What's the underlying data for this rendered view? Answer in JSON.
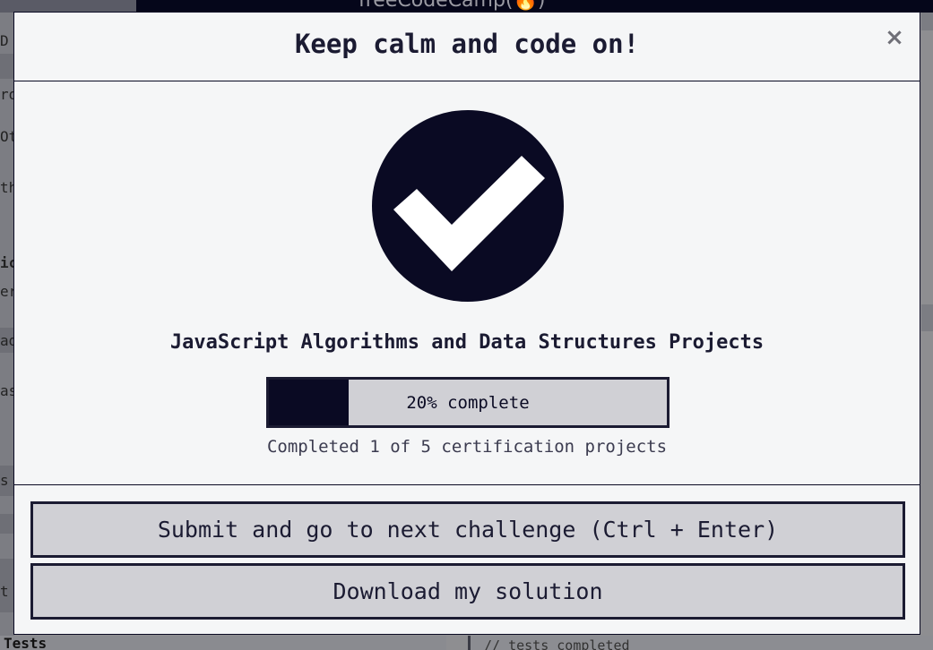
{
  "background": {
    "logo_text": "freeCodeCamp(🔥)",
    "left_fragments": [
      "D",
      "ro",
      "Ot",
      "th",
      "ic",
      "er",
      "ad",
      "as",
      "s",
      "t"
    ],
    "tests_label": "Tests",
    "code_snippet": "// tests completed"
  },
  "modal": {
    "title": "Keep calm and code on!",
    "close_symbol": "×",
    "success_icon": "checkmark-circle-icon",
    "certification_title": "JavaScript Algorithms and Data Structures Projects",
    "progress": {
      "fraction": 0.2,
      "label": "20% complete"
    },
    "progress_caption": "Completed 1 of 5 certification projects",
    "submit_label": "Submit and go to next challenge (Ctrl + Enter)",
    "download_label": "Download my solution"
  },
  "colors": {
    "primary_dark": "#0a0a23",
    "button_bg": "#d0d0d5",
    "modal_bg": "#f5f6f7"
  }
}
